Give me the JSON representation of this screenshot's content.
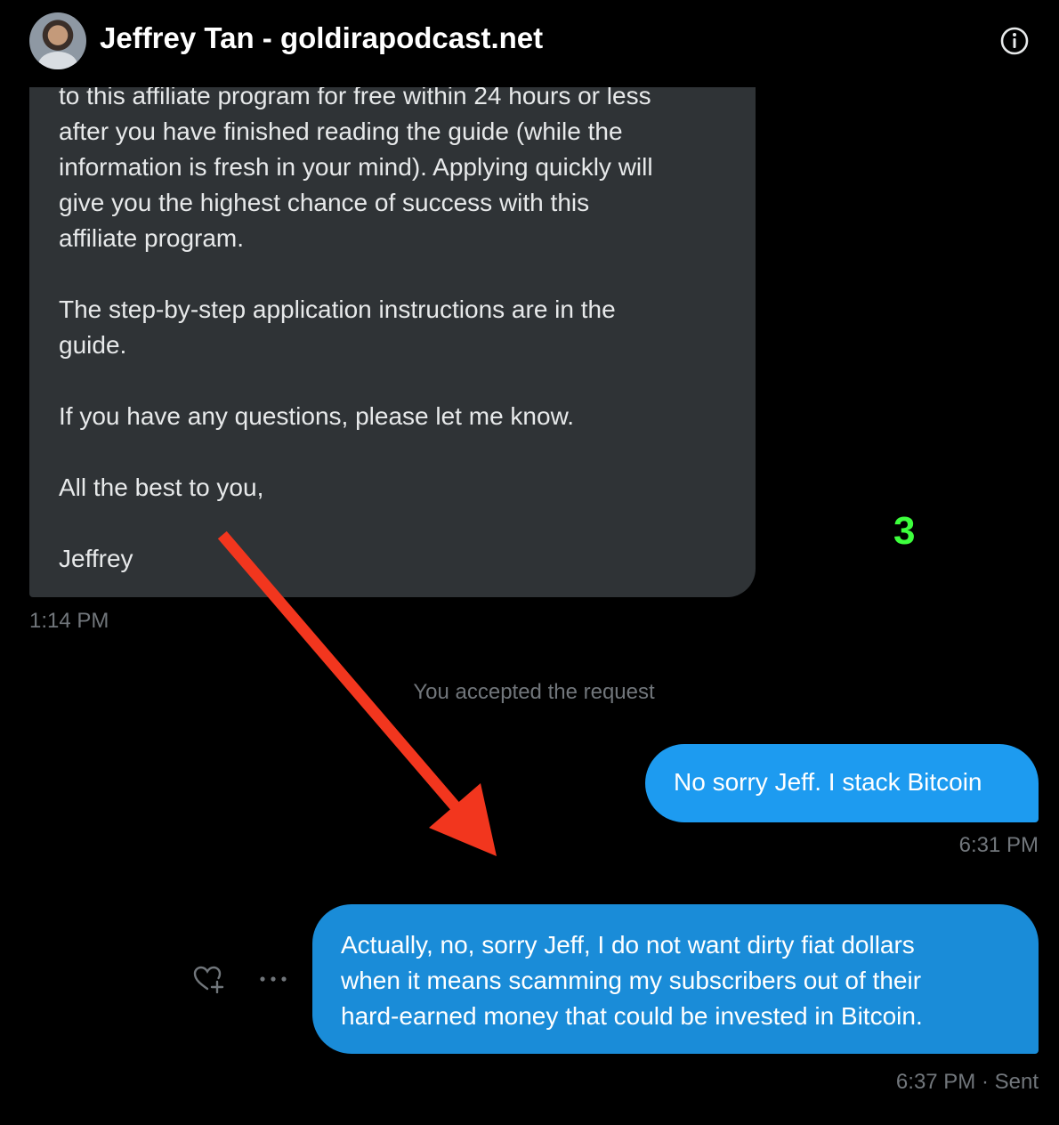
{
  "header": {
    "title": "Jeffrey Tan - goldirapodcast.net",
    "avatar_icon": "profile-photo",
    "info_icon": "info-icon"
  },
  "incoming_message": {
    "text": "to this affiliate program for free within 24 hours or less\nafter you have finished reading the guide (while the\ninformation is fresh in your mind). Applying quickly will\ngive you the highest chance of success with this\naffiliate program.\n\nThe step-by-step application instructions are in the\nguide.\n\nIf you have any questions, please let me know.\n\nAll the best to you,\n\nJeffrey",
    "time": "1:14 PM"
  },
  "system_notice": "You accepted the request",
  "outgoing_messages": [
    {
      "text": "No sorry Jeff. I stack Bitcoin",
      "time": "6:31 PM"
    },
    {
      "text": "Actually, no, sorry Jeff, I do not want dirty fiat dollars\nwhen it means scamming my subscribers out of their\nhard-earned money that could be invested in Bitcoin.",
      "time": "6:37 PM · Sent"
    }
  ],
  "message_actions": {
    "react_icon": "heart-plus-icon",
    "more_icon": "more-horizontal-icon"
  },
  "annotation": {
    "number": "3",
    "number_color": "#3dff3d",
    "arrow_color": "#f2361e"
  },
  "colors": {
    "background": "#000000",
    "incoming_bubble": "#2f3336",
    "outgoing_bubble": "#1d9bf0",
    "muted_text": "#71767b"
  }
}
